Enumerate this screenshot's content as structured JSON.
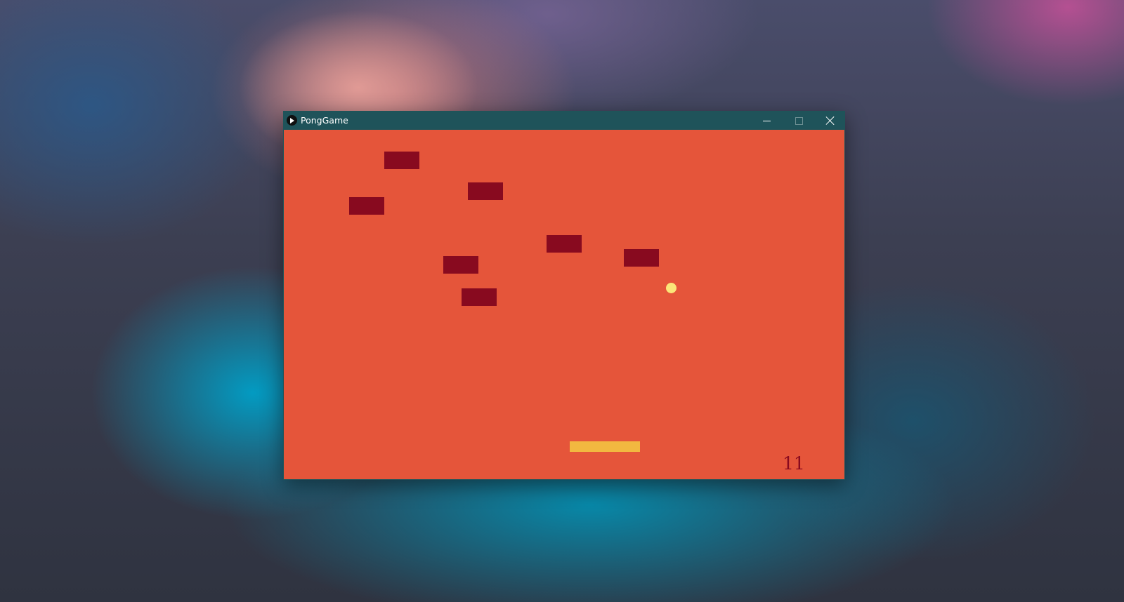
{
  "window": {
    "title": "PongGame",
    "controls": {
      "minimize": "minimize-icon",
      "maximize": "maximize-icon",
      "close": "close-icon"
    }
  },
  "game": {
    "score": "11",
    "colors": {
      "background": "#e5553a",
      "brick": "#880a1f",
      "ball": "#fbe679",
      "paddle": "#f2b840",
      "titlebar": "#1f535a"
    }
  }
}
